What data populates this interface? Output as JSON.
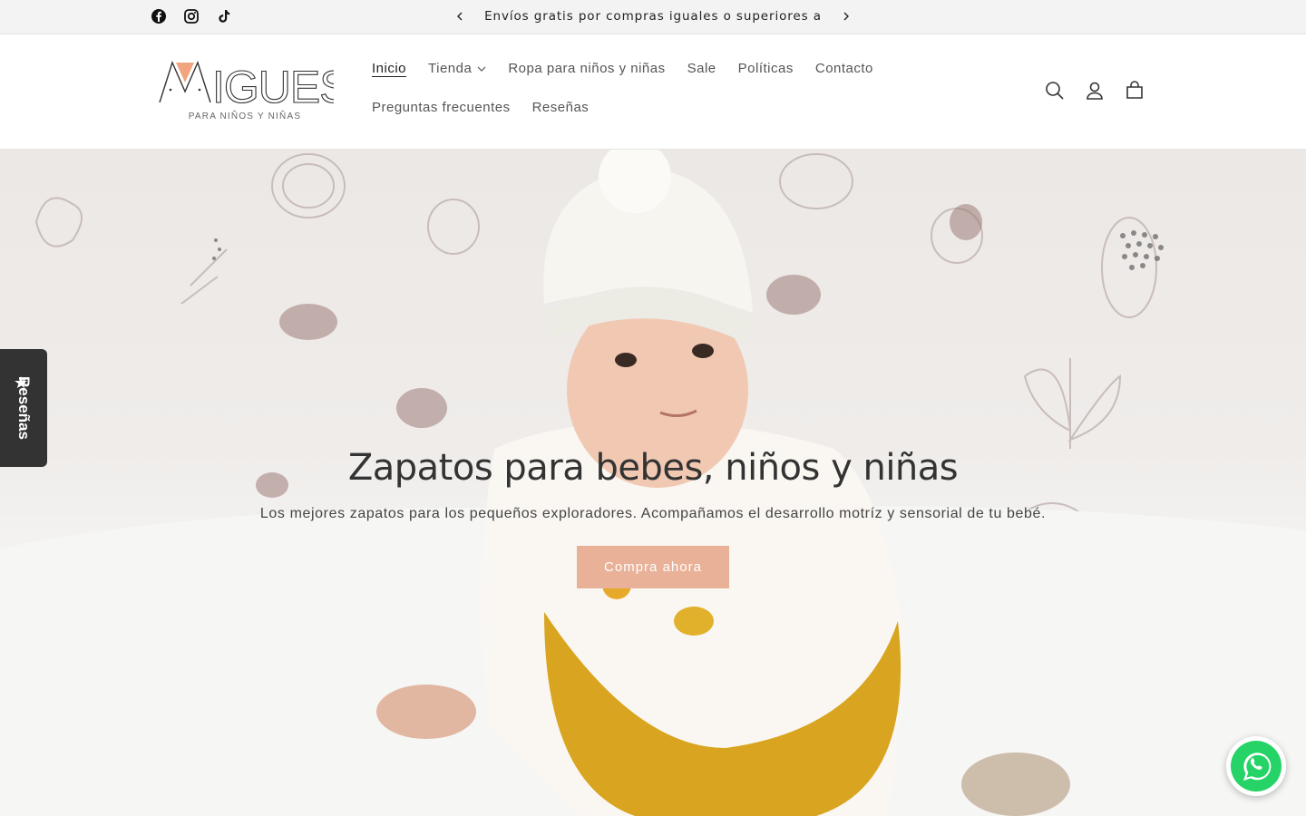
{
  "announcement": {
    "text": "Envíos gratis por compras iguales o superiores a",
    "social": [
      "facebook-icon",
      "instagram-icon",
      "tiktok-icon"
    ]
  },
  "logo": {
    "subtitle": "PARA NIÑOS Y NIÑAS"
  },
  "nav": {
    "row1": [
      "Inicio",
      "Tienda",
      "Ropa para niños y niñas",
      "Sale",
      "Políticas",
      "Contacto"
    ],
    "row2": [
      "Preguntas frecuentes",
      "Reseñas"
    ]
  },
  "header_icons": [
    "search-icon",
    "account-icon",
    "cart-icon"
  ],
  "hero": {
    "title": "Zapatos para bebes, niños y niñas",
    "subtitle": "Los mejores zapatos para los pequeños exploradores. Acompañamos el desarrollo motríz y sensorial de tu bebé.",
    "cta": "Compra ahora"
  },
  "reviews_tab": {
    "label": "Reseñas"
  },
  "colors": {
    "accent": "#e8b198",
    "reviews_tab": "#333333",
    "whatsapp": "#25d366"
  }
}
